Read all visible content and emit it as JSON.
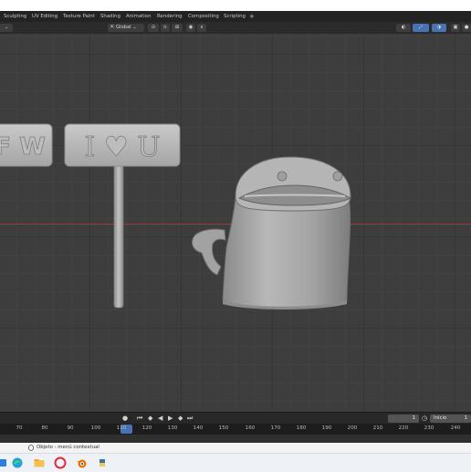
{
  "workspace_tabs": [
    {
      "label": "Sculpting",
      "active": false
    },
    {
      "label": "UV Editing",
      "active": false
    },
    {
      "label": "Texture Paint",
      "active": false
    },
    {
      "label": "Shading",
      "active": false
    },
    {
      "label": "Animation",
      "active": false
    },
    {
      "label": "Rendering",
      "active": false
    },
    {
      "label": "Compositing",
      "active": false
    },
    {
      "label": "Scripting",
      "active": false
    }
  ],
  "add_workspace_label": "+",
  "header": {
    "orientation_label": "Global"
  },
  "model_text": {
    "left_sign": "F W",
    "right_sign": "I ♥ U"
  },
  "timeline": {
    "current_frame": "1",
    "start_label": "Inicio",
    "start_value": "1",
    "ruler_ticks": [
      "70",
      "80",
      "90",
      "100",
      "110",
      "120",
      "130",
      "140",
      "150",
      "160",
      "170",
      "180",
      "190",
      "200",
      "210",
      "220",
      "230",
      "240"
    ],
    "ruler_current": "1"
  },
  "status_bar": {
    "text": "Objeto - menú contextual"
  },
  "taskbar_apps": [
    "search-app-icon",
    "edge-icon",
    "file-explorer-icon",
    "opera-icon",
    "blender-icon",
    "python-icon"
  ],
  "colors": {
    "viewport_bg": "#3d3d3d",
    "x_axis": "#a03a3a",
    "accent_blue": "#4772b3",
    "model_gray": "#a9a9a9"
  }
}
